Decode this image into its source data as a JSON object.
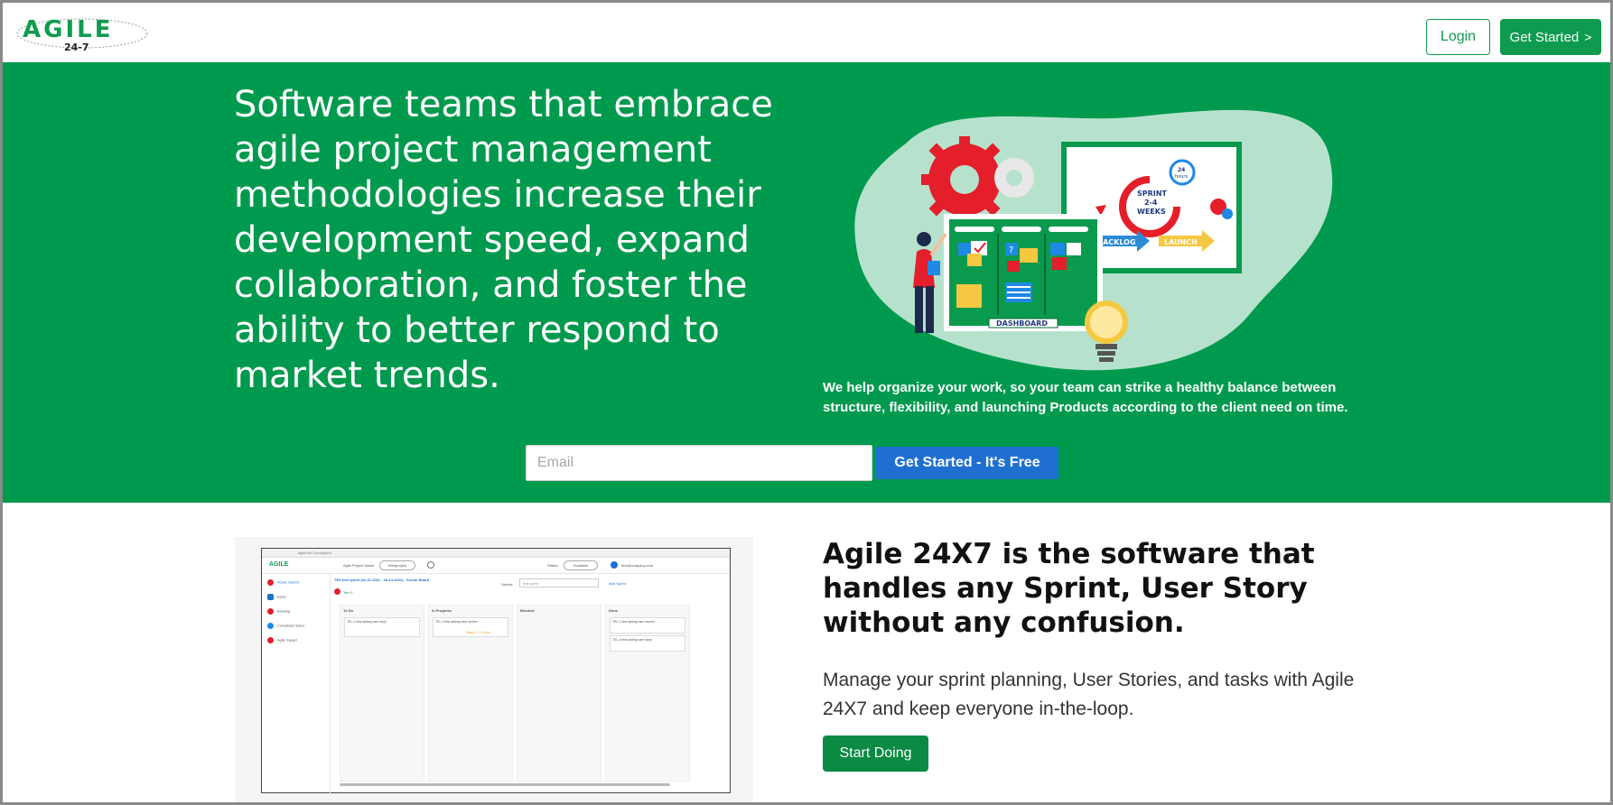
{
  "header": {
    "logo_text": "AGILE",
    "logo_sub": "24-7",
    "login_label": "Login",
    "get_started_label": "Get Started",
    "get_started_icon": "chevron-right-icon"
  },
  "hero": {
    "headline": "Software teams that embrace agile project management methodologies increase their development speed, expand collaboration, and foster the ability to better respond to market trends.",
    "illustration": {
      "board_label": "DASHBOARD",
      "sprint_label_1": "SPRINT",
      "sprint_label_2": "2-4",
      "sprint_label_3": "WEEKS",
      "hours_label_1": "24",
      "hours_label_2": "hours",
      "backlog_label": "BACKLOG",
      "launch_label": "LAUNCH"
    },
    "subtext": "We help organize your work, so your team can strike a healthy balance between structure, flexibility, and launching Products according to the client need on time.",
    "email_placeholder": "Email",
    "cta_label": "Get Started - It's Free"
  },
  "feature": {
    "title": "Agile 24X7 is the software that handles any Sprint, User Story without any confusion.",
    "description": "Manage your sprint planning, User Stories, and tasks with Agile 24X7 and keep everyone in-the-loop.",
    "cta_label": "Start Doing",
    "screenshot": {
      "url": "agile24x7.com/sprint",
      "project_name_label": "Agile Project Name",
      "project_select": "Webproject",
      "status_label": "Status:",
      "status_value": "Available",
      "user_email": "test@company.com",
      "sprint_title": "TES test sprint (02-21-2021 - 03-14-2021) - Scrum Board",
      "sprints_label": "Sprints",
      "sprints_select": "test sprint",
      "add_sprint": "Add Sprint",
      "team_label": "Tem 1",
      "sidebar": [
        "Active Sprints",
        "Epics",
        "Backlog",
        "Completed Epics",
        "Agile Squad"
      ],
      "columns": [
        "To Do",
        "In Progress",
        "Blocked",
        "Done"
      ],
      "cards": {
        "todo": [
          "TEL-2 test adding user story"
        ],
        "in_progress": [
          "TEL-3 test adding user stories"
        ],
        "in_progress_badge": "Status: 0 % Done",
        "done": [
          "TEL-1 test adding user stories",
          "TEL-4 test adding user story"
        ]
      }
    }
  }
}
